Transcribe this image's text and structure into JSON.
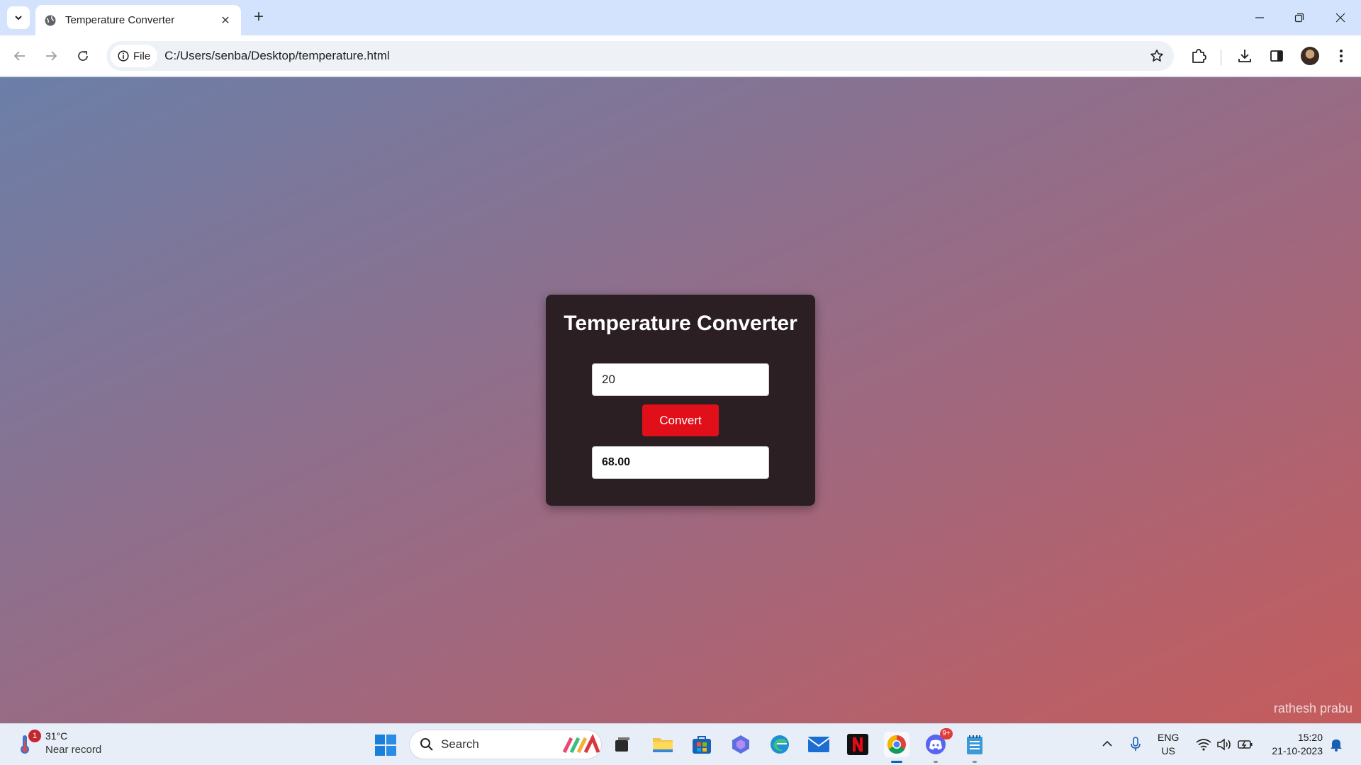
{
  "browser": {
    "tab_title": "Temperature Converter",
    "site_chip_label": "File",
    "url": "C:/Users/senba/Desktop/temperature.html"
  },
  "page": {
    "card_title": "Temperature Converter",
    "input_value": "20",
    "convert_label": "Convert",
    "result_value": "68.00",
    "watermark": "rathesh prabu"
  },
  "taskbar": {
    "weather_badge": "1",
    "weather_temp": "31°C",
    "weather_desc": "Near record",
    "search_label": "Search",
    "discord_badge": "9+",
    "lang_line1": "ENG",
    "lang_line2": "US",
    "time": "15:20",
    "date": "21-10-2023"
  },
  "colors": {
    "accent_button": "#e10f1a",
    "card_bg": "#2b1f24",
    "gradient_start": "#6b7fa8",
    "gradient_end": "#c55c5c"
  }
}
